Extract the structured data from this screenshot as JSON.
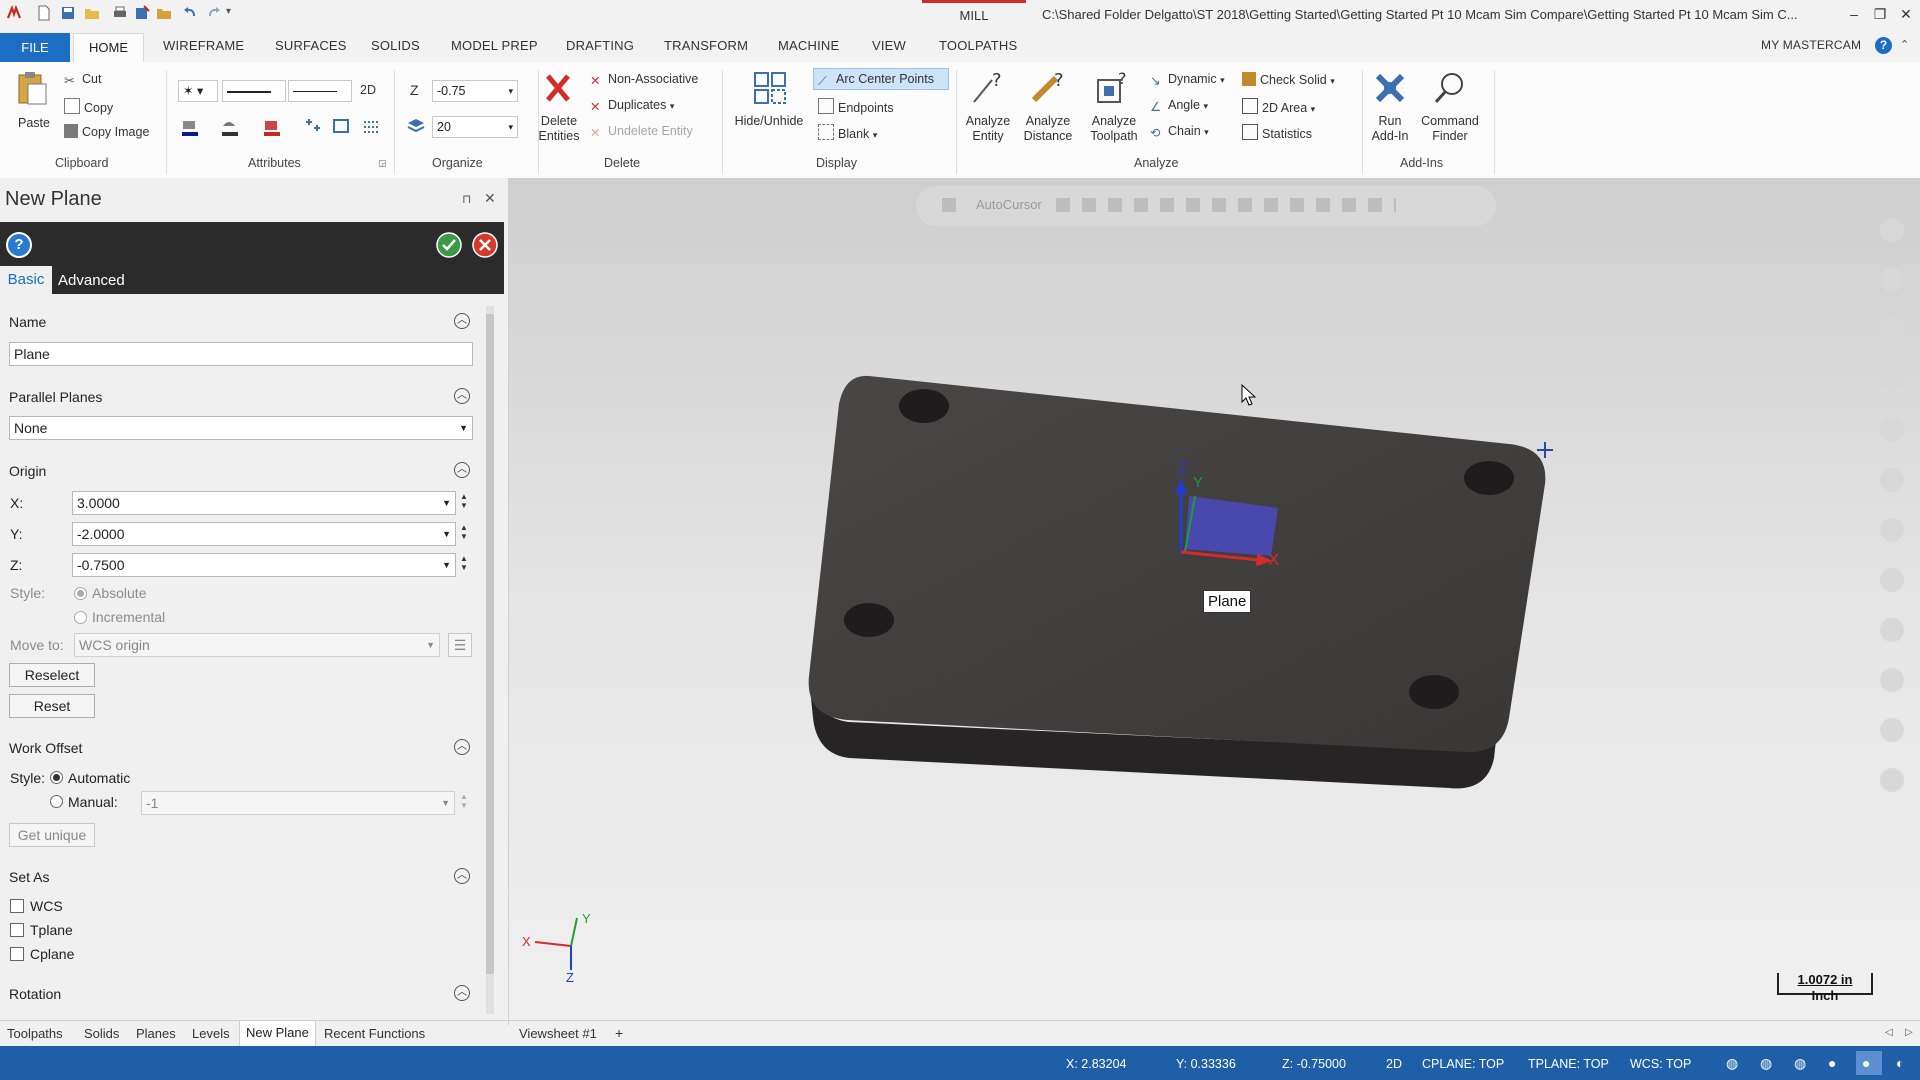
{
  "titlebar": {
    "mill": "MILL",
    "path": "C:\\Shared Folder Delgatto\\ST 2018\\Getting Started\\Getting Started Pt 10 Mcam Sim Compare\\Getting Started Pt 10 Mcam Sim C...",
    "min": "–",
    "restore": "❐",
    "close": "✕"
  },
  "tabs": {
    "file": "FILE",
    "home": "HOME",
    "wireframe": "WIREFRAME",
    "surfaces": "SURFACES",
    "solids": "SOLIDS",
    "model_prep": "MODEL PREP",
    "drafting": "DRAFTING",
    "transform": "TRANSFORM",
    "machine": "MACHINE",
    "view": "VIEW",
    "toolpaths": "TOOLPATHS",
    "my_mastercam": "MY MASTERCAM"
  },
  "ribbon": {
    "clipboard": {
      "label": "Clipboard",
      "paste": "Paste",
      "cut": "Cut",
      "copy": "Copy",
      "copy_image": "Copy Image"
    },
    "attributes": {
      "label": "Attributes",
      "mode_2d": "2D"
    },
    "organize": {
      "label": "Organize",
      "z_label": "Z",
      "z_value": "-0.75",
      "level_value": "20"
    },
    "delete": {
      "label": "Delete",
      "delete_entities": "Delete\nEntities",
      "non_associative": "Non-Associative",
      "duplicates": "Duplicates",
      "undelete": "Undelete Entity"
    },
    "display": {
      "label": "Display",
      "hide_unhide": "Hide/Unhide",
      "arc_center": "Arc Center Points",
      "endpoints": "Endpoints",
      "blank": "Blank"
    },
    "analyze": {
      "label": "Analyze",
      "analyze_entity": "Analyze\nEntity",
      "analyze_distance": "Analyze\nDistance",
      "analyze_toolpath": "Analyze\nToolpath",
      "dynamic": "Dynamic",
      "angle": "Angle",
      "chain": "Chain",
      "check_solid": "Check Solid",
      "area_2d": "2D Area",
      "statistics": "Statistics"
    },
    "addins": {
      "label": "Add-Ins",
      "run_addin": "Run\nAdd-In",
      "command_finder": "Command\nFinder"
    }
  },
  "panel": {
    "title": "New Plane",
    "pin": "⊓",
    "close": "✕",
    "tab_basic": "Basic",
    "tab_advanced": "Advanced",
    "name": {
      "header": "Name",
      "value": "Plane"
    },
    "parallel": {
      "header": "Parallel Planes",
      "value": "None"
    },
    "origin": {
      "header": "Origin",
      "x_label": "X:",
      "x": "3.0000",
      "y_label": "Y:",
      "y": "-2.0000",
      "z_label": "Z:",
      "z": "-0.7500",
      "style_label": "Style:",
      "absolute": "Absolute",
      "incremental": "Incremental",
      "move_to_label": "Move to:",
      "move_to": "WCS origin",
      "reselect": "Reselect",
      "reset": "Reset"
    },
    "work_offset": {
      "header": "Work Offset",
      "style_label": "Style:",
      "automatic": "Automatic",
      "manual": "Manual:",
      "manual_value": "-1",
      "get_unique": "Get unique"
    },
    "set_as": {
      "header": "Set As",
      "wcs": "WCS",
      "tplane": "Tplane",
      "cplane": "Cplane"
    },
    "rotation": {
      "header": "Rotation"
    }
  },
  "panel_tabs": [
    "Toolpaths",
    "Solids",
    "Planes",
    "Levels",
    "New Plane",
    "Recent Functions"
  ],
  "viewport": {
    "autocursor": "AutoCursor",
    "plane_tooltip": "Plane",
    "axis_x": "X",
    "axis_y": "Y",
    "axis_z": "Z",
    "scale_value": "1.0072 in",
    "scale_unit": "Inch"
  },
  "viewsheet": {
    "tab": "Viewsheet #1",
    "add": "+"
  },
  "status": {
    "x": "X:   2.83204",
    "y": "Y:   0.33336",
    "z": "Z:   -0.75000",
    "mode": "2D",
    "cplane": "CPLANE: TOP",
    "tplane": "TPLANE: TOP",
    "wcs": "WCS: TOP"
  },
  "colors": {
    "accent": "#1b6ec2",
    "status_bar": "#1f5fa8",
    "mill_tag": "#d32c2c",
    "part": "#3a3838",
    "plane_fill": "#4b4bc8"
  }
}
